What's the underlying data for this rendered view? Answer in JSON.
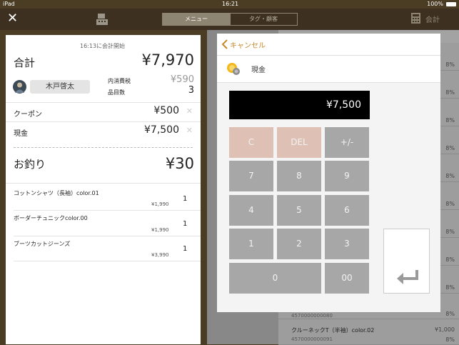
{
  "status_bar": {
    "device": "iPad",
    "time": "16:21",
    "battery": "100%"
  },
  "top_nav": {
    "close_icon": "close-x-icon",
    "register_icon": "cash-register-icon",
    "tab_menu": "メニュー",
    "tab_tags": "タグ・顧客",
    "checkout_label": "会計",
    "checkout_icon": "calculator-icon"
  },
  "receipt": {
    "started_at": "16:13に会計開始",
    "total_label": "合計",
    "total_value": "¥7,970",
    "customer_name": "木戸啓太",
    "tax_label": "内消費税",
    "tax_value": "¥590",
    "count_label": "品目数",
    "count_value": "3",
    "payments": [
      {
        "label": "クーポン",
        "amount": "¥500"
      },
      {
        "label": "現金",
        "amount": "¥7,500"
      }
    ],
    "change_label": "お釣り",
    "change_value": "¥30",
    "items": [
      {
        "name": "コットンシャツ（長袖）color.01",
        "price": "¥1,990",
        "qty": "1"
      },
      {
        "name": "ボーダーチュニックcolor.00",
        "price": "¥1,990",
        "qty": "1"
      },
      {
        "name": "ブーツカットジーンズ",
        "price": "¥3,990",
        "qty": "1"
      }
    ]
  },
  "background_list": {
    "rows": [
      {
        "percent": "8%"
      },
      {
        "percent": "8%"
      },
      {
        "percent": "8%"
      },
      {
        "percent": "8%"
      },
      {
        "percent": "8%"
      },
      {
        "percent": "8%"
      },
      {
        "percent": "8%"
      },
      {
        "percent": "8%"
      },
      {
        "percent": "8%"
      },
      {
        "percent": "8%",
        "code": "4570000000080"
      }
    ],
    "last_item": {
      "name": "クルーネックT（半袖）color.02",
      "code": "4570000000091",
      "price": "¥1,000",
      "percent": "8%"
    }
  },
  "modal": {
    "cancel_label": "キャンセル",
    "method_label": "現金",
    "display_value": "¥7,500",
    "keys": {
      "clear": "C",
      "del": "DEL",
      "sign": "+/-",
      "seven": "7",
      "eight": "8",
      "nine": "9",
      "four": "4",
      "five": "5",
      "six": "6",
      "one": "1",
      "two": "2",
      "three": "3",
      "zero": "0",
      "double_zero": "00"
    }
  },
  "colors": {
    "header": "#3d3020",
    "accent_orange": "#c8892b",
    "key_gray": "#a7a7a7",
    "key_pink": "#dfc0b4"
  }
}
